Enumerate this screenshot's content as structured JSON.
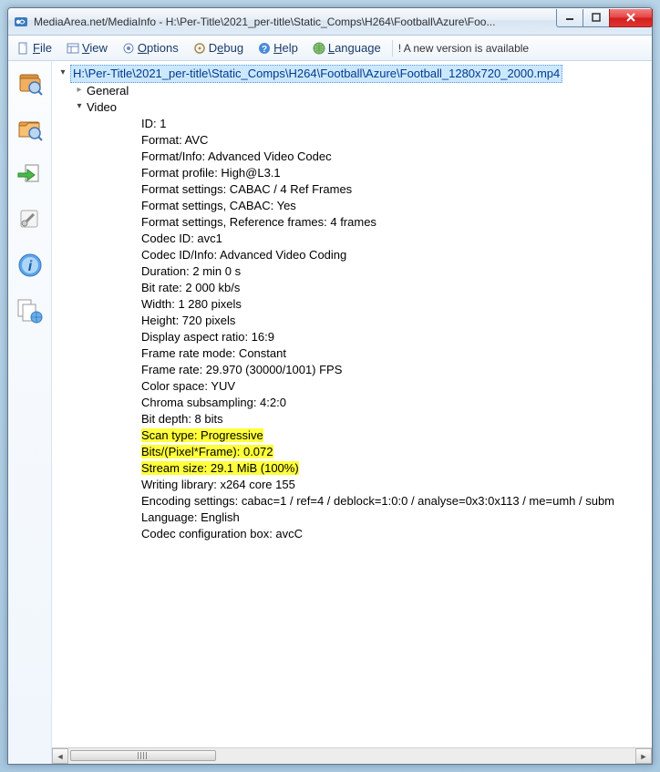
{
  "window": {
    "title": "MediaArea.net/MediaInfo - H:\\Per-Title\\2021_per-title\\Static_Comps\\H264\\Football\\Azure\\Foo..."
  },
  "menubar": {
    "file": "File",
    "view": "View",
    "options": "Options",
    "debug": "Debug",
    "help": "Help",
    "language": "Language",
    "version": "! A new version is available"
  },
  "tree": {
    "root_label": "H:\\Per-Title\\2021_per-title\\Static_Comps\\H264\\Football\\Azure\\Football_1280x720_2000.mp4",
    "general_label": "General",
    "video_label": "Video",
    "video_props": [
      "ID: 1",
      "Format: AVC",
      "Format/Info: Advanced Video Codec",
      "Format profile: High@L3.1",
      "Format settings: CABAC / 4 Ref Frames",
      "Format settings, CABAC: Yes",
      "Format settings, Reference frames: 4 frames",
      "Codec ID: avc1",
      "Codec ID/Info: Advanced Video Coding",
      "Duration: 2 min 0 s",
      "Bit rate: 2 000 kb/s",
      "Width: 1 280 pixels",
      "Height: 720 pixels",
      "Display aspect ratio: 16:9",
      "Frame rate mode: Constant",
      "Frame rate: 29.970 (30000/1001) FPS",
      "Color space: YUV",
      "Chroma subsampling: 4:2:0",
      "Bit depth: 8 bits",
      "Scan type: Progressive",
      "Bits/(Pixel*Frame): 0.072",
      "Stream size: 29.1 MiB (100%)",
      "Writing library: x264 core 155",
      "Encoding settings: cabac=1 / ref=4 / deblock=1:0:0 / analyse=0x3:0x113 / me=umh / subm",
      "Language: English",
      "Codec configuration box: avcC"
    ],
    "highlight_indexes": [
      19,
      20,
      21
    ]
  }
}
